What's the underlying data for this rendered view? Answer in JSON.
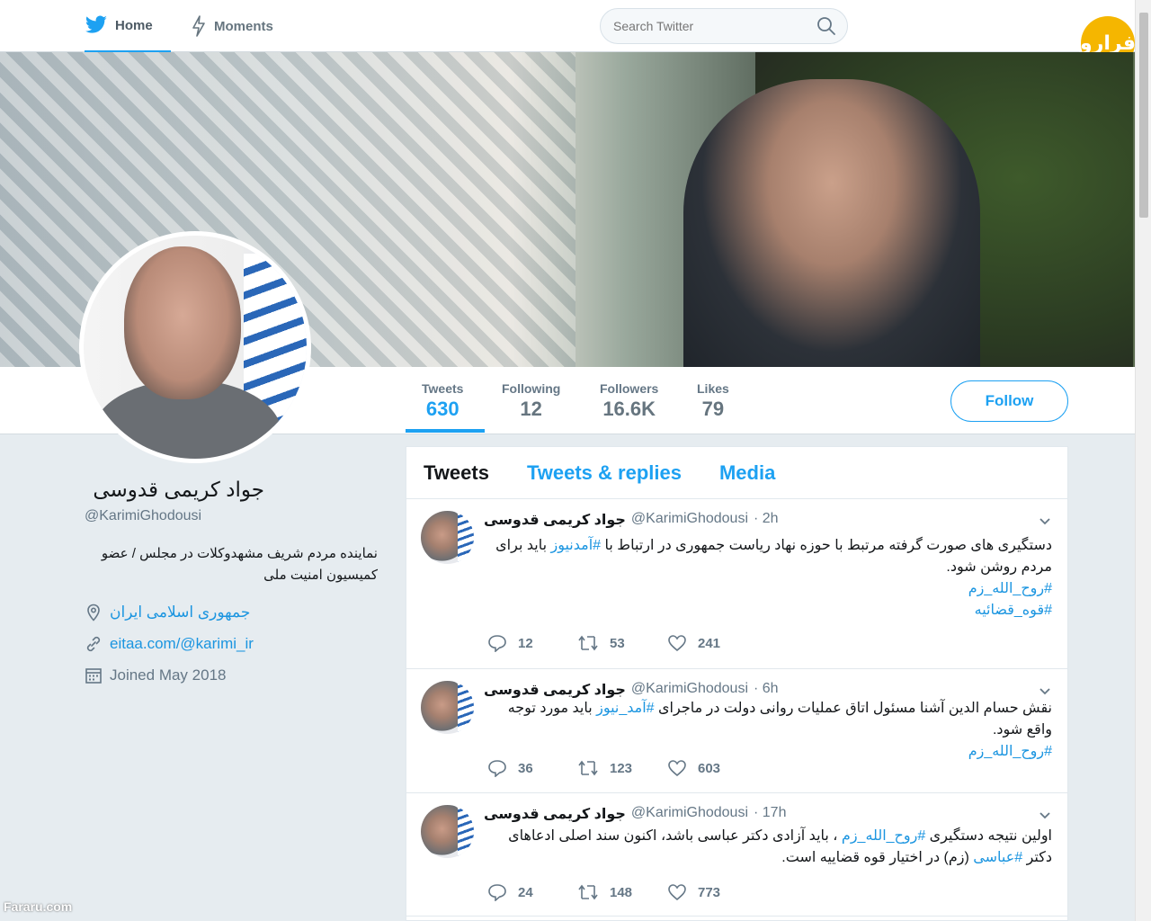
{
  "nav": {
    "home_label": "Home",
    "moments_label": "Moments",
    "search_placeholder": "Search Twitter"
  },
  "brand": {
    "logo_text": "فرارو"
  },
  "profile": {
    "name": "جواد کریمی قدوسی",
    "handle": "@KarimiGhodousi",
    "bio": "نماینده مردم شریف مشهدوکلات در مجلس / عضو کمیسیون امنیت ملی",
    "location": "جمهوری اسلامی ایران",
    "website": "eitaa.com/@karimi_ir",
    "joined": "Joined May 2018"
  },
  "stats": {
    "tweets_label": "Tweets",
    "tweets_value": "630",
    "following_label": "Following",
    "following_value": "12",
    "followers_label": "Followers",
    "followers_value": "16.6K",
    "likes_label": "Likes",
    "likes_value": "79"
  },
  "follow_label": "Follow",
  "tabs": [
    "Tweets",
    "Tweets & replies",
    "Media"
  ],
  "tweets": [
    {
      "name": "جواد کریمی قدوسی",
      "handle": "@KarimiGhodousi",
      "time": "· 2h",
      "text_before": "دستگیری های صورت گرفته مرتبط با حوزه نهاد ریاست جمهوری در ارتباط با ",
      "hashtag_inline": "#آمدنیوز",
      "text_after": " باید برای مردم روشن شود.",
      "hashtag_line1": "#روح_الله_زم",
      "hashtag_line2": "#قوه_قضائیه",
      "replies": "12",
      "retweets": "53",
      "likes": "241"
    },
    {
      "name": "جواد کریمی قدوسی",
      "handle": "@KarimiGhodousi",
      "time": "· 6h",
      "text_before": "نقش حسام الدین آشنا مسئول اتاق عملیات روانی دولت در ماجرای ",
      "hashtag_inline": "#آمد_نیوز",
      "text_after": " باید مورد توجه واقع شود.",
      "hashtag_line1": "#روح_الله_زم",
      "replies": "36",
      "retweets": "123",
      "likes": "603"
    },
    {
      "name": "جواد کریمی قدوسی",
      "handle": "@KarimiGhodousi",
      "time": "· 17h",
      "text_before": "اولین نتیجه دستگیری ",
      "hashtag_inline": "#روح_الله_زم",
      "text_middle": " ، باید آزادی دکتر عباسی باشد، اکنون سند اصلی ادعاهای دکتر ",
      "hashtag_inline2": "#عباسی",
      "text_after": " (زم) در اختیار قوه قضاییه است.",
      "replies": "24",
      "retweets": "148",
      "likes": "773"
    }
  ],
  "watermark": "Fararu.com",
  "colors": {
    "accent": "#1da1f2",
    "link": "#1b95e0",
    "background": "#e6ecf0",
    "brand_logo": "#f5b600"
  }
}
